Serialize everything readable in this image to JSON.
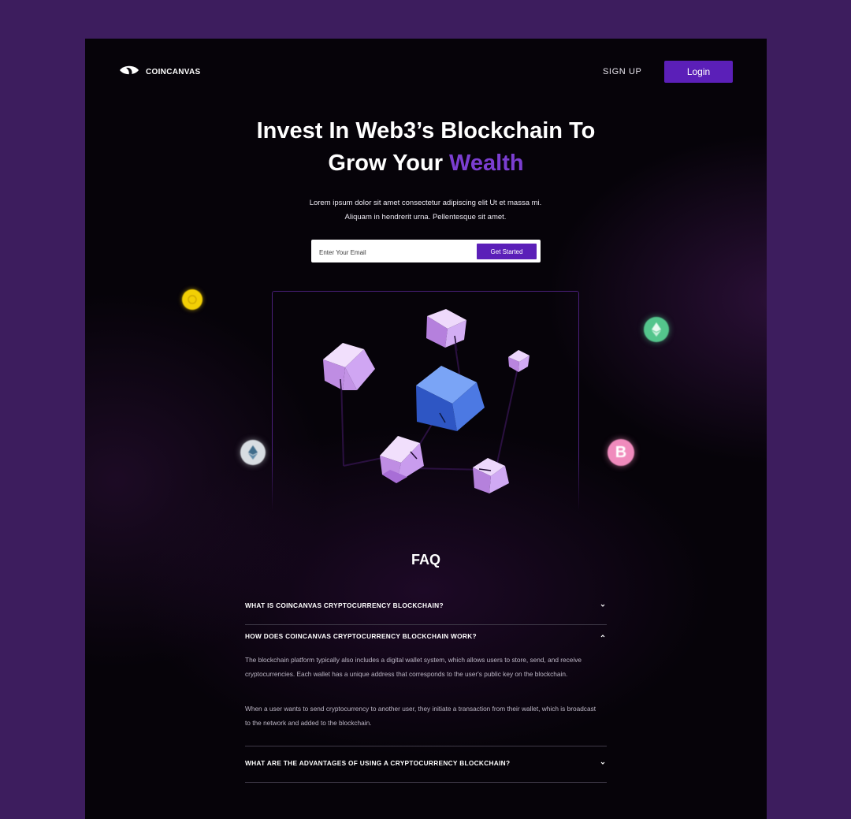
{
  "brand": {
    "name": "COINCANVAS"
  },
  "nav": {
    "signup": "SIGN UP",
    "login": "Login"
  },
  "hero": {
    "title_line1": "Invest In Web3’s Blockchain To",
    "title_line2_prefix": "Grow Your ",
    "title_accent": "Wealth",
    "desc_line1": "Lorem ipsum dolor sit amet consectetur adipiscing elit Ut et massa mi.",
    "desc_line2": "Aliquam in hendrerit urna. Pellentesque sit amet."
  },
  "signup_form": {
    "email_placeholder": "Enter Your Email",
    "button": "Get Started"
  },
  "coins": [
    {
      "name": "gold-coin",
      "color": "#f2cf05"
    },
    {
      "name": "ethereum-green-coin",
      "color": "#54c58c"
    },
    {
      "name": "ethereum-silver-coin",
      "color": "#d8dde2"
    },
    {
      "name": "bitcoin-pink-coin",
      "color": "#f08bbd",
      "symbol": "B"
    }
  ],
  "faq": {
    "title": "FAQ",
    "items": [
      {
        "question": "WHAT IS COINCANVAS CRYPTOCURRENCY BLOCKCHAIN?",
        "expanded": false
      },
      {
        "question": "HOW DOES COINCANVAS CRYPTOCURRENCY BLOCKCHAIN WORK?",
        "expanded": true,
        "answer_p1": "The blockchain platform typically also includes a digital wallet system, which allows users to store, send, and receive cryptocurrencies. Each wallet has a unique address that corresponds to the user's public key on the blockchain.",
        "answer_p2": "When a user wants to send cryptocurrency to another user, they initiate a transaction from their wallet, which is broadcast to the network and added to the blockchain."
      },
      {
        "question": "WHAT ARE THE ADVANTAGES OF USING A CRYPTOCURRENCY BLOCKCHAIN?",
        "expanded": false
      }
    ]
  },
  "colors": {
    "accent": "#5b1fb8",
    "accent_text": "#7b3ed1",
    "page_bg": "#3d1d5e",
    "frame_bg": "#060309"
  }
}
